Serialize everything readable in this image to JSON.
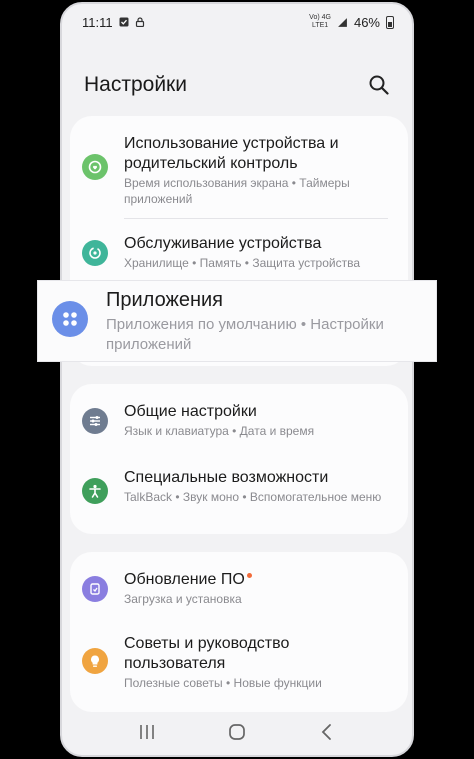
{
  "status_bar": {
    "time": "11:11",
    "battery_text": "46%",
    "network_label_top": "Vo) 4G",
    "network_label_bottom": "LTE1"
  },
  "header": {
    "title": "Настройки",
    "search_icon": "search-icon"
  },
  "sections": [
    {
      "items": [
        {
          "title": "Использование устройства и родительский контроль",
          "subtitle": "Время использования экрана • Таймеры приложений",
          "icon": "digital-wellbeing-icon",
          "icon_color": "#6cc36b"
        },
        {
          "title": "Обслуживание устройства",
          "subtitle": "Хранилище • Память • Защита устройства",
          "icon": "device-care-icon",
          "icon_color": "#3fb59a"
        }
      ]
    },
    {
      "items": [
        {
          "title": "Общие настройки",
          "subtitle": "Язык и клавиатура • Дата и время",
          "icon": "sliders-icon",
          "icon_color": "#6f7c90"
        },
        {
          "title": "Специальные возможности",
          "subtitle": "TalkBack • Звук моно • Вспомогательное меню",
          "icon": "accessibility-icon",
          "icon_color": "#3f9f5b"
        }
      ]
    },
    {
      "items": [
        {
          "title": "Обновление ПО",
          "subtitle": "Загрузка и установка",
          "icon": "software-update-icon",
          "icon_color": "#8a7ee0",
          "has_badge": true
        },
        {
          "title": "Советы и руководство пользователя",
          "subtitle": "Полезные советы • Новые функции",
          "icon": "lightbulb-icon",
          "icon_color": "#f0a440"
        }
      ]
    }
  ],
  "highlighted_item": {
    "title": "Приложения",
    "subtitle": "Приложения по умолчанию • Настройки приложений",
    "icon": "apps-grid-icon",
    "icon_color": "#6b8fe8"
  },
  "nav_bar": {
    "recents": "recents-icon",
    "home": "home-icon",
    "back": "back-icon"
  }
}
